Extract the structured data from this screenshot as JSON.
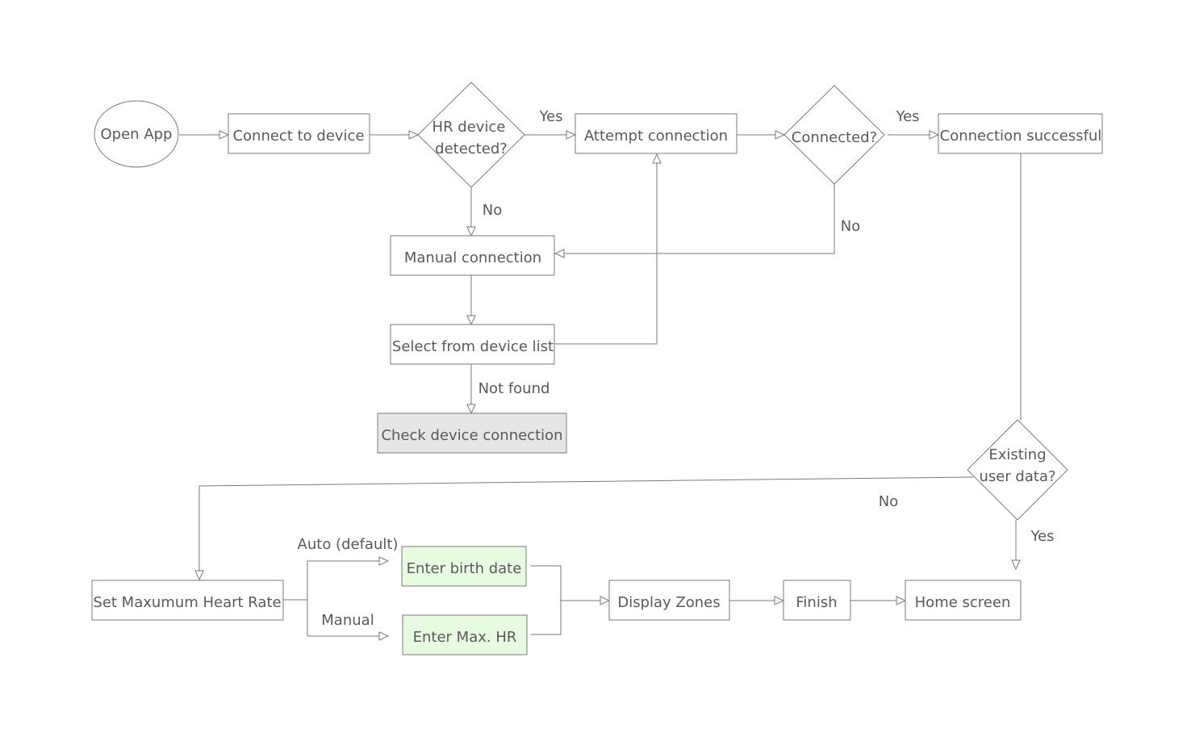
{
  "colors": {
    "stroke": "#7a7a7a",
    "text": "#595959",
    "highlight_green": "#e6fbe0",
    "highlight_grey": "#e6e6e6"
  },
  "nodes": {
    "open_app": "Open App",
    "connect_device": "Connect to device",
    "hr_detected": [
      "HR device",
      "detected?"
    ],
    "attempt_connection": "Attempt connection",
    "connected": "Connected?",
    "connection_successful": "Connection successful",
    "manual_connection": "Manual connection",
    "select_device": "Select from device list",
    "check_device": "Check device connection",
    "existing_data": [
      "Existing",
      "user data?"
    ],
    "set_max_hr": "Set Maxumum Heart Rate",
    "enter_birth": "Enter birth date",
    "enter_max_hr": "Enter Max. HR",
    "display_zones": "Display Zones",
    "finish": "Finish",
    "home_screen": "Home screen"
  },
  "edge_labels": {
    "hr_yes": "Yes",
    "connected_yes": "Yes",
    "hr_no": "No",
    "connected_no": "No",
    "not_found": "Not found",
    "existing_no": "No",
    "existing_yes": "Yes",
    "auto": "Auto (default)",
    "manual": "Manual"
  }
}
